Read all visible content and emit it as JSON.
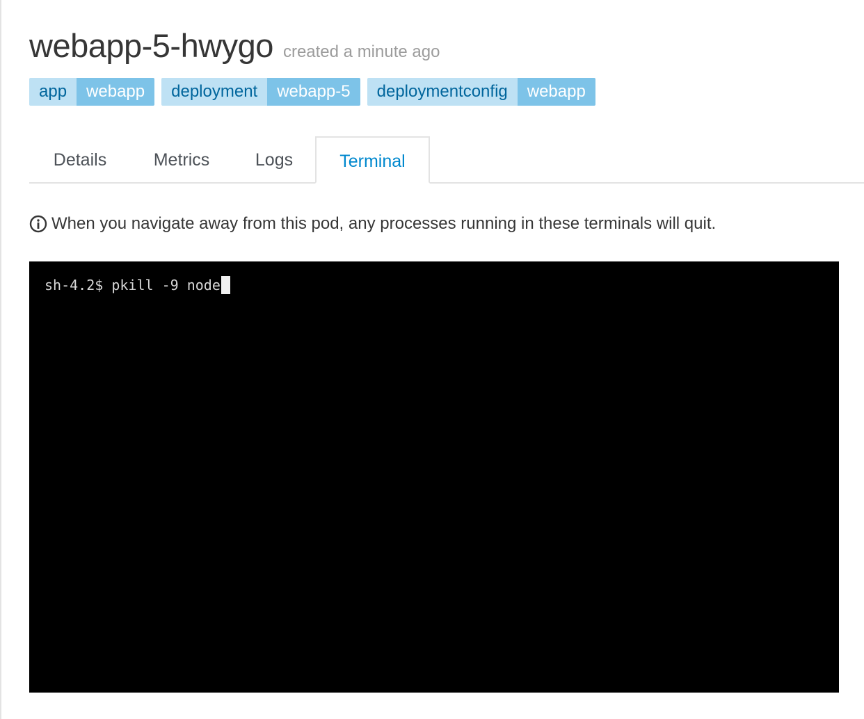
{
  "header": {
    "pod_name": "webapp-5-hwygo",
    "created": "created a minute ago"
  },
  "labels": [
    {
      "key": "app",
      "value": "webapp"
    },
    {
      "key": "deployment",
      "value": "webapp-5"
    },
    {
      "key": "deploymentconfig",
      "value": "webapp"
    }
  ],
  "tabs": [
    {
      "label": "Details",
      "active": false
    },
    {
      "label": "Metrics",
      "active": false
    },
    {
      "label": "Logs",
      "active": false
    },
    {
      "label": "Terminal",
      "active": true
    }
  ],
  "notice": {
    "icon": "info-circle-icon",
    "text": "When you navigate away from this pod, any processes running in these terminals will quit."
  },
  "terminal": {
    "prompt": "sh-4.2$ ",
    "command": "pkill -9 node"
  },
  "colors": {
    "label_key_bg": "#bee1f4",
    "label_value_bg": "#7dc3e8",
    "active_tab": "#0088ce",
    "terminal_bg": "#000000"
  }
}
